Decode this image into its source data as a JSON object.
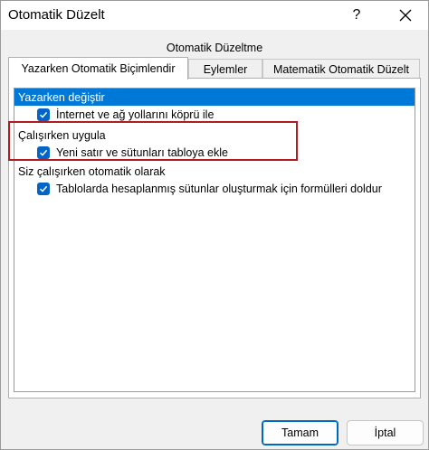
{
  "window": {
    "title": "Otomatik Düzelt",
    "help_label": "?",
    "close_label": "✕"
  },
  "group_label": "Otomatik Düzeltme",
  "tabs": [
    {
      "label": "Yazarken Otomatik Biçimlendir",
      "active": true
    },
    {
      "label": "Eylemler",
      "active": false
    },
    {
      "label": "Matematik Otomatik Düzelt",
      "active": false
    }
  ],
  "sections": [
    {
      "header": "Yazarken değiştir",
      "selected": true,
      "items": [
        {
          "label": "İnternet ve ağ yollarını köprü ile",
          "checked": true
        }
      ]
    },
    {
      "header": "Çalışırken uygula",
      "selected": false,
      "items": [
        {
          "label": "Yeni satır ve sütunları tabloya ekle",
          "checked": true
        }
      ]
    },
    {
      "header": "Siz çalışırken otomatik olarak",
      "selected": false,
      "items": [
        {
          "label": "Tablolarda hesaplanmış sütunlar oluşturmak için formülleri doldur",
          "checked": true
        }
      ]
    }
  ],
  "buttons": {
    "ok_label": "Tamam",
    "cancel_label": "İptal"
  },
  "colors": {
    "selection": "#0078d7",
    "checkbox": "#0064c8",
    "highlight_border": "#b01c22"
  },
  "icons": {
    "checkbox": "checkmark-icon",
    "close": "close-icon",
    "help": "help-icon"
  }
}
